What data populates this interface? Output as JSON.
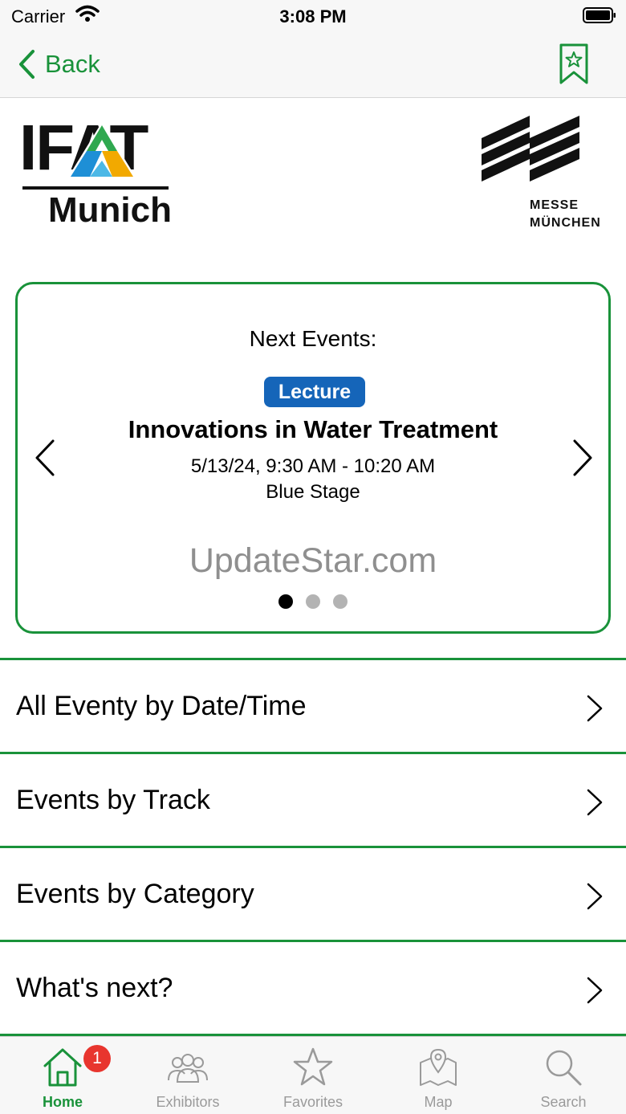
{
  "status_bar": {
    "carrier": "Carrier",
    "time": "3:08 PM"
  },
  "nav": {
    "back_label": "Back",
    "bookmark_icon": "bookmark-star-icon"
  },
  "logos": {
    "ifat_text": "IFAT",
    "ifat_city": "Munich",
    "messe_line1": "MESSE",
    "messe_line2": "MÜNCHEN"
  },
  "next_events": {
    "heading": "Next Events:",
    "badge": "Lecture",
    "title": "Innovations in Water Treatment",
    "time": "5/13/24, 9:30 AM - 10:20 AM",
    "location": "Blue Stage",
    "watermark": "UpdateStar.com",
    "page_count": 3,
    "current_page": 1
  },
  "menu": {
    "items": [
      {
        "label": "All Eventy by Date/Time"
      },
      {
        "label": "Events by Track"
      },
      {
        "label": "Events by Category"
      },
      {
        "label": "What's next?"
      }
    ]
  },
  "tabs": {
    "items": [
      {
        "label": "Home",
        "icon": "home-icon",
        "badge": "1",
        "active": true
      },
      {
        "label": "Exhibitors",
        "icon": "exhibitors-icon",
        "active": false
      },
      {
        "label": "Favorites",
        "icon": "star-icon",
        "active": false
      },
      {
        "label": "Map",
        "icon": "map-icon",
        "active": false
      },
      {
        "label": "Search",
        "icon": "search-icon",
        "active": false
      }
    ]
  },
  "colors": {
    "accent": "#19923a",
    "badge_blue": "#1565b9",
    "notification_red": "#e8352e"
  }
}
